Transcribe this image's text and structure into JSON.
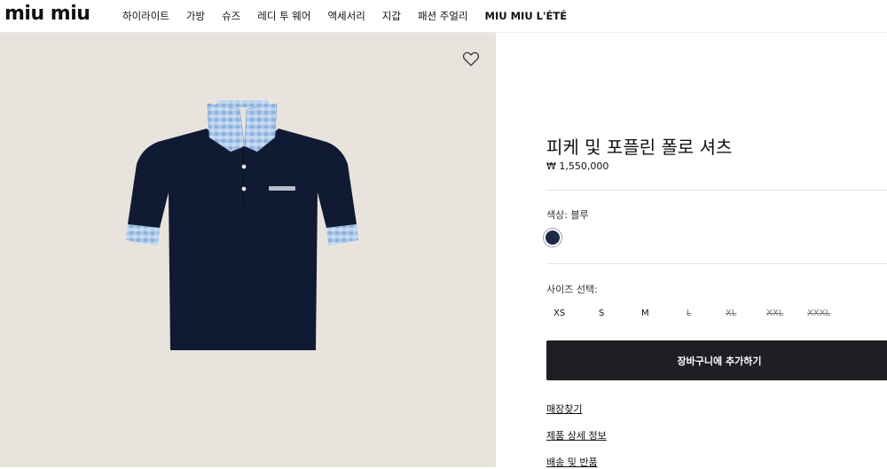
{
  "brand": {
    "logo": "miu miu"
  },
  "nav": [
    {
      "label": "하이라이트"
    },
    {
      "label": "가방"
    },
    {
      "label": "슈즈"
    },
    {
      "label": "레디 투 웨어"
    },
    {
      "label": "액세서리"
    },
    {
      "label": "지갑"
    },
    {
      "label": "패션 주얼리"
    },
    {
      "label": "MIU MIU L'ÉTÉ"
    }
  ],
  "product": {
    "title": "피케 및 포플린 폴로 셔츠",
    "price": "₩ 1,550,000",
    "color_label": "색상: 블루",
    "color_swatch": "#1c2a47",
    "size_label": "사이즈 선택:",
    "sizes": [
      {
        "label": "XS",
        "available": true
      },
      {
        "label": "S",
        "available": true
      },
      {
        "label": "M",
        "available": true
      },
      {
        "label": "L",
        "available": false
      },
      {
        "label": "XL",
        "available": false
      },
      {
        "label": "XXL",
        "available": false
      },
      {
        "label": "XXXL",
        "available": false
      }
    ],
    "add_to_cart": "장바구니에 추가하기",
    "links": [
      "매장찾기",
      "제품 상세 정보",
      "배송 및 반품"
    ]
  },
  "icons": {
    "wishlist": "heart-outline-icon"
  },
  "colors": {
    "image_bg": "#e8e4dd",
    "button_bg": "#1e1f22",
    "shirt": "#111a33",
    "collar": "#8fb3da"
  }
}
